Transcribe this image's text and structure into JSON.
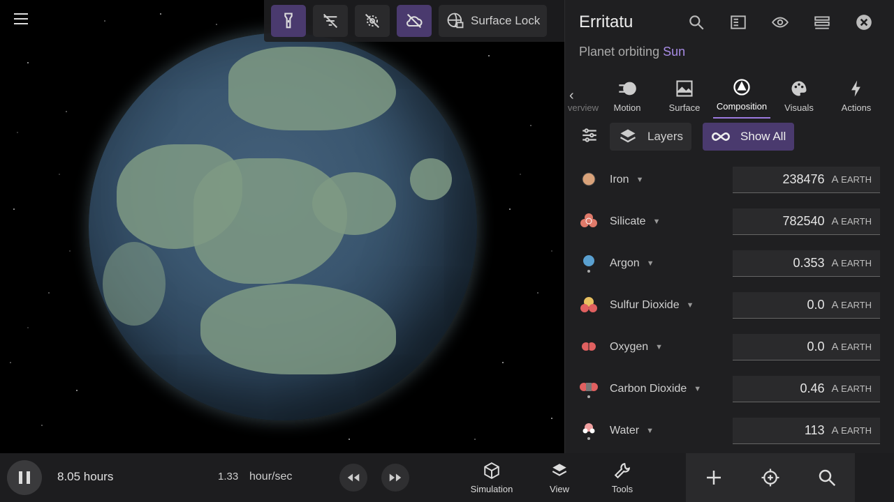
{
  "viewport": {
    "surface_lock_label": "Surface Lock",
    "toolbar_buttons": [
      "flashlight-icon",
      "filter-off-icon",
      "gear-off-icon",
      "cloud-off-icon"
    ]
  },
  "panel": {
    "title": "Erritatu",
    "subtitle_prefix": "Planet orbiting ",
    "subtitle_link": "Sun",
    "tabs": [
      {
        "label": "verview",
        "icon": "overview-icon"
      },
      {
        "label": "Motion",
        "icon": "motion-icon"
      },
      {
        "label": "Surface",
        "icon": "surface-icon"
      },
      {
        "label": "Composition",
        "icon": "composition-icon"
      },
      {
        "label": "Visuals",
        "icon": "palette-icon"
      },
      {
        "label": "Actions",
        "icon": "lightning-icon"
      }
    ],
    "filters": {
      "layers_label": "Layers",
      "show_all_label": "Show All"
    },
    "unit_prefix": "A",
    "unit_label": "EARTH",
    "components": [
      {
        "name": "Iron",
        "value": "238476",
        "color": "#d9a27a"
      },
      {
        "name": "Silicate",
        "value": "782540",
        "color": "#e07a6a"
      },
      {
        "name": "Argon",
        "value": "0.353",
        "color": "#5aa0d0"
      },
      {
        "name": "Sulfur Dioxide",
        "value": "0.0",
        "color": "#e8c060"
      },
      {
        "name": "Oxygen",
        "value": "0.0",
        "color": "#e06060"
      },
      {
        "name": "Carbon Dioxide",
        "value": "0.46",
        "color": "#e06060"
      },
      {
        "name": "Water",
        "value": "113",
        "color": "#f0a0a0"
      }
    ]
  },
  "bottom": {
    "time": "8.05 hours",
    "rate_value": "1.33",
    "rate_unit": "hour/sec",
    "nav": [
      {
        "label": "Simulation",
        "icon": "cube-icon"
      },
      {
        "label": "View",
        "icon": "layers-icon"
      },
      {
        "label": "Tools",
        "icon": "wrench-icon"
      }
    ]
  },
  "colors": {
    "accent": "#4a3a6e",
    "link": "#a88ce6",
    "panel_bg": "#1f1f21"
  }
}
